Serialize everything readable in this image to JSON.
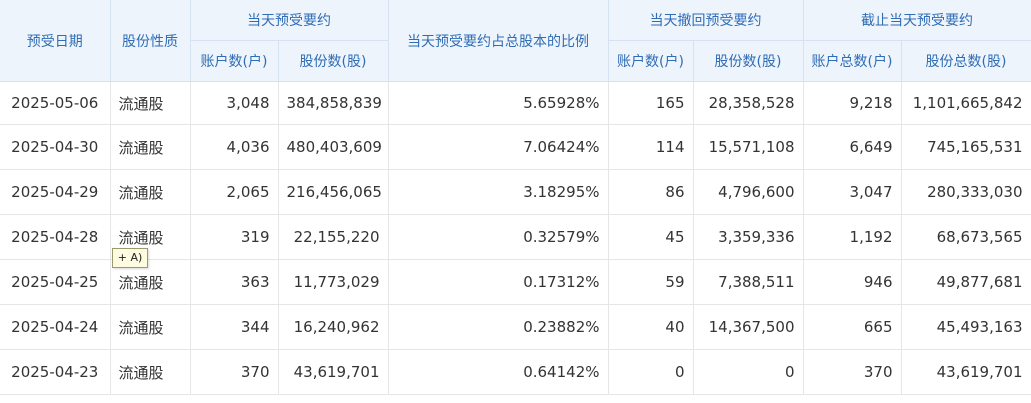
{
  "headers": {
    "date": "预受日期",
    "type": "股份性质",
    "group_today": "当天预受要约",
    "group_ratio": "当天预受要约占总股本的比例",
    "group_withdraw": "当天撤回预受要约",
    "group_cumulative": "截止当天预受要约",
    "accounts": "账户数(户)",
    "shares": "股份数(股)",
    "total_accounts": "账户总数(户)",
    "total_shares": "股份总数(股)"
  },
  "rows": [
    {
      "date": "2025-05-06",
      "type": "流通股",
      "accounts": "3,048",
      "shares": "384,858,839",
      "ratio": "5.65928%",
      "w_accounts": "165",
      "w_shares": "28,358,528",
      "t_accounts": "9,218",
      "t_shares": "1,101,665,842"
    },
    {
      "date": "2025-04-30",
      "type": "流通股",
      "accounts": "4,036",
      "shares": "480,403,609",
      "ratio": "7.06424%",
      "w_accounts": "114",
      "w_shares": "15,571,108",
      "t_accounts": "6,649",
      "t_shares": "745,165,531"
    },
    {
      "date": "2025-04-29",
      "type": "流通股",
      "accounts": "2,065",
      "shares": "216,456,065",
      "ratio": "3.18295%",
      "w_accounts": "86",
      "w_shares": "4,796,600",
      "t_accounts": "3,047",
      "t_shares": "280,333,030"
    },
    {
      "date": "2025-04-28",
      "type": "流通股",
      "accounts": "319",
      "shares": "22,155,220",
      "ratio": "0.32579%",
      "w_accounts": "45",
      "w_shares": "3,359,336",
      "t_accounts": "1,192",
      "t_shares": "68,673,565"
    },
    {
      "date": "2025-04-25",
      "type": "流通股",
      "accounts": "363",
      "shares": "11,773,029",
      "ratio": "0.17312%",
      "w_accounts": "59",
      "w_shares": "7,388,511",
      "t_accounts": "946",
      "t_shares": "49,877,681"
    },
    {
      "date": "2025-04-24",
      "type": "流通股",
      "accounts": "344",
      "shares": "16,240,962",
      "ratio": "0.23882%",
      "w_accounts": "40",
      "w_shares": "14,367,500",
      "t_accounts": "665",
      "t_shares": "45,493,163"
    },
    {
      "date": "2025-04-23",
      "type": "流通股",
      "accounts": "370",
      "shares": "43,619,701",
      "ratio": "0.64142%",
      "w_accounts": "0",
      "w_shares": "0",
      "t_accounts": "370",
      "t_shares": "43,619,701"
    }
  ],
  "tooltip": "+ A)"
}
